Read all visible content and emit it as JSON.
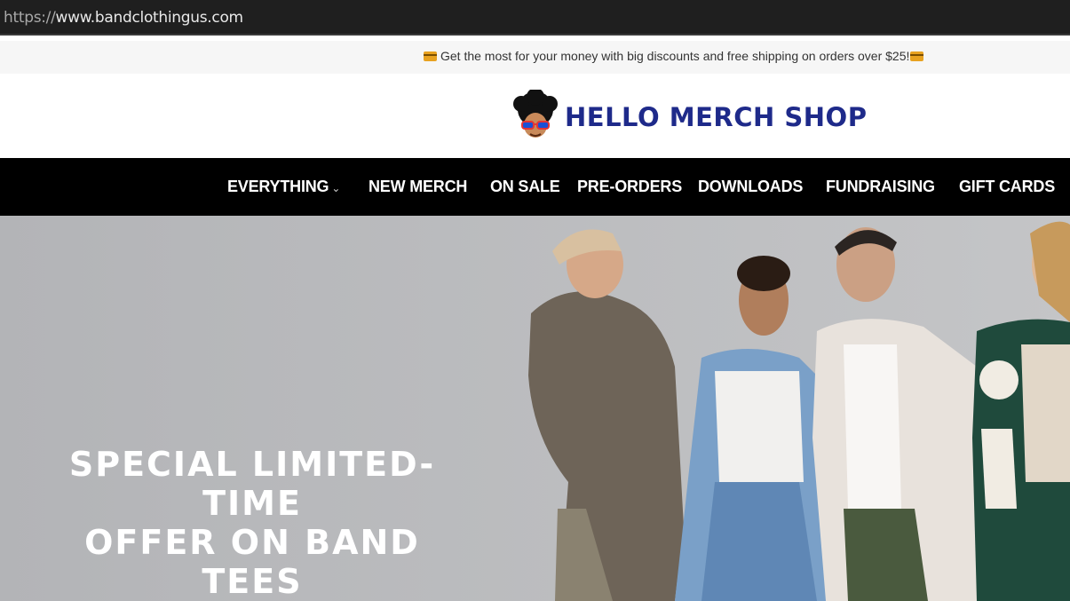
{
  "browser": {
    "url_scheme": "https://",
    "url_host": "www.bandclothingus.com"
  },
  "promo": {
    "message": "Get the most for your money with big discounts and free shipping on orders over $25!",
    "icon": "credit-card-icon"
  },
  "header": {
    "logo_text": "HELLO MERCH SHOP",
    "logo_icon": "afro-sunglasses-mascot-icon"
  },
  "nav": {
    "items": [
      {
        "label": "EVERYTHING",
        "has_dropdown": true
      },
      {
        "label": "NEW MERCH"
      },
      {
        "label": "ON SALE"
      },
      {
        "label": "PRE-ORDERS"
      },
      {
        "label": "DOWNLOADS"
      },
      {
        "label": "FUNDRAISING"
      },
      {
        "label": "GIFT CARDS"
      }
    ],
    "dropdown_icon": "chevron-down-icon"
  },
  "hero": {
    "title_line1": "SPECIAL LIMITED-TIME",
    "title_line2": "OFFER ON BAND TEES"
  },
  "colors": {
    "address_bar_bg": "#1f1f1f",
    "promo_bg": "#f6f6f6",
    "nav_bg": "#000000",
    "brand_blue": "#1e2a8a",
    "hero_bg": "#b7b8ba"
  }
}
